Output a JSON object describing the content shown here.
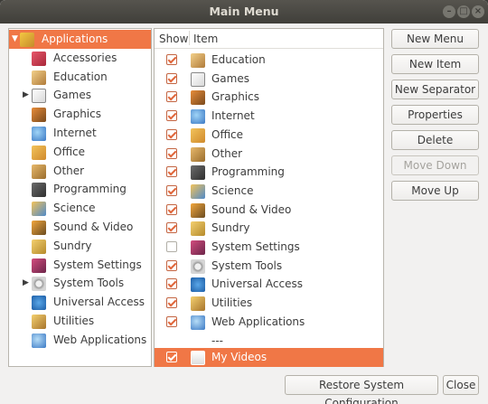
{
  "window": {
    "title": "Main Menu"
  },
  "tree": {
    "items": [
      {
        "label": "Applications",
        "icon": "applications-icon",
        "selected": true,
        "expander": "expanded"
      },
      {
        "label": "Accessories",
        "icon": "accessories-icon"
      },
      {
        "label": "Education",
        "icon": "education-icon"
      },
      {
        "label": "Games",
        "icon": "games-icon",
        "expander": "collapsed"
      },
      {
        "label": "Graphics",
        "icon": "graphics-icon"
      },
      {
        "label": "Internet",
        "icon": "internet-icon"
      },
      {
        "label": "Office",
        "icon": "office-icon"
      },
      {
        "label": "Other",
        "icon": "other-icon"
      },
      {
        "label": "Programming",
        "icon": "programming-icon"
      },
      {
        "label": "Science",
        "icon": "science-icon"
      },
      {
        "label": "Sound & Video",
        "icon": "sound-video-icon"
      },
      {
        "label": "Sundry",
        "icon": "sundry-icon"
      },
      {
        "label": "System Settings",
        "icon": "system-settings-icon"
      },
      {
        "label": "System Tools",
        "icon": "system-tools-icon",
        "expander": "collapsed"
      },
      {
        "label": "Universal Access",
        "icon": "universal-access-icon"
      },
      {
        "label": "Utilities",
        "icon": "utilities-icon"
      },
      {
        "label": "Web Applications",
        "icon": "web-applications-icon"
      }
    ]
  },
  "list": {
    "header": {
      "show": "Show",
      "item": "Item"
    },
    "rows": [
      {
        "label": "Education",
        "checked": true,
        "icon": "education-icon"
      },
      {
        "label": "Games",
        "checked": true,
        "icon": "games-icon"
      },
      {
        "label": "Graphics",
        "checked": true,
        "icon": "graphics-icon"
      },
      {
        "label": "Internet",
        "checked": true,
        "icon": "internet-icon"
      },
      {
        "label": "Office",
        "checked": true,
        "icon": "office-icon"
      },
      {
        "label": "Other",
        "checked": true,
        "icon": "other-icon"
      },
      {
        "label": "Programming",
        "checked": true,
        "icon": "programming-icon"
      },
      {
        "label": "Science",
        "checked": true,
        "icon": "science-icon"
      },
      {
        "label": "Sound & Video",
        "checked": true,
        "icon": "sound-video-icon"
      },
      {
        "label": "Sundry",
        "checked": true,
        "icon": "sundry-icon"
      },
      {
        "label": "System Settings",
        "checked": false,
        "icon": "system-settings-icon"
      },
      {
        "label": "System Tools",
        "checked": true,
        "icon": "system-tools-icon"
      },
      {
        "label": "Universal Access",
        "checked": true,
        "icon": "universal-access-icon"
      },
      {
        "label": "Utilities",
        "checked": true,
        "icon": "utilities-icon"
      },
      {
        "label": "Web Applications",
        "checked": true,
        "icon": "web-applications-icon"
      },
      {
        "label": "---",
        "separator": true
      },
      {
        "label": "My Videos",
        "checked": true,
        "icon": "video-file-icon",
        "selected": true
      }
    ]
  },
  "buttons": {
    "new_menu": "New Menu",
    "new_item": "New Item",
    "new_separator": "New Separator",
    "properties": "Properties",
    "delete": "Delete",
    "move_down": "Move Down",
    "move_up": "Move Up",
    "restore": "Restore System Configuration",
    "close": "Close"
  },
  "colors": {
    "selection": "#f07746",
    "titlebar": "#4a4944",
    "window_bg": "#f2f1f0"
  }
}
